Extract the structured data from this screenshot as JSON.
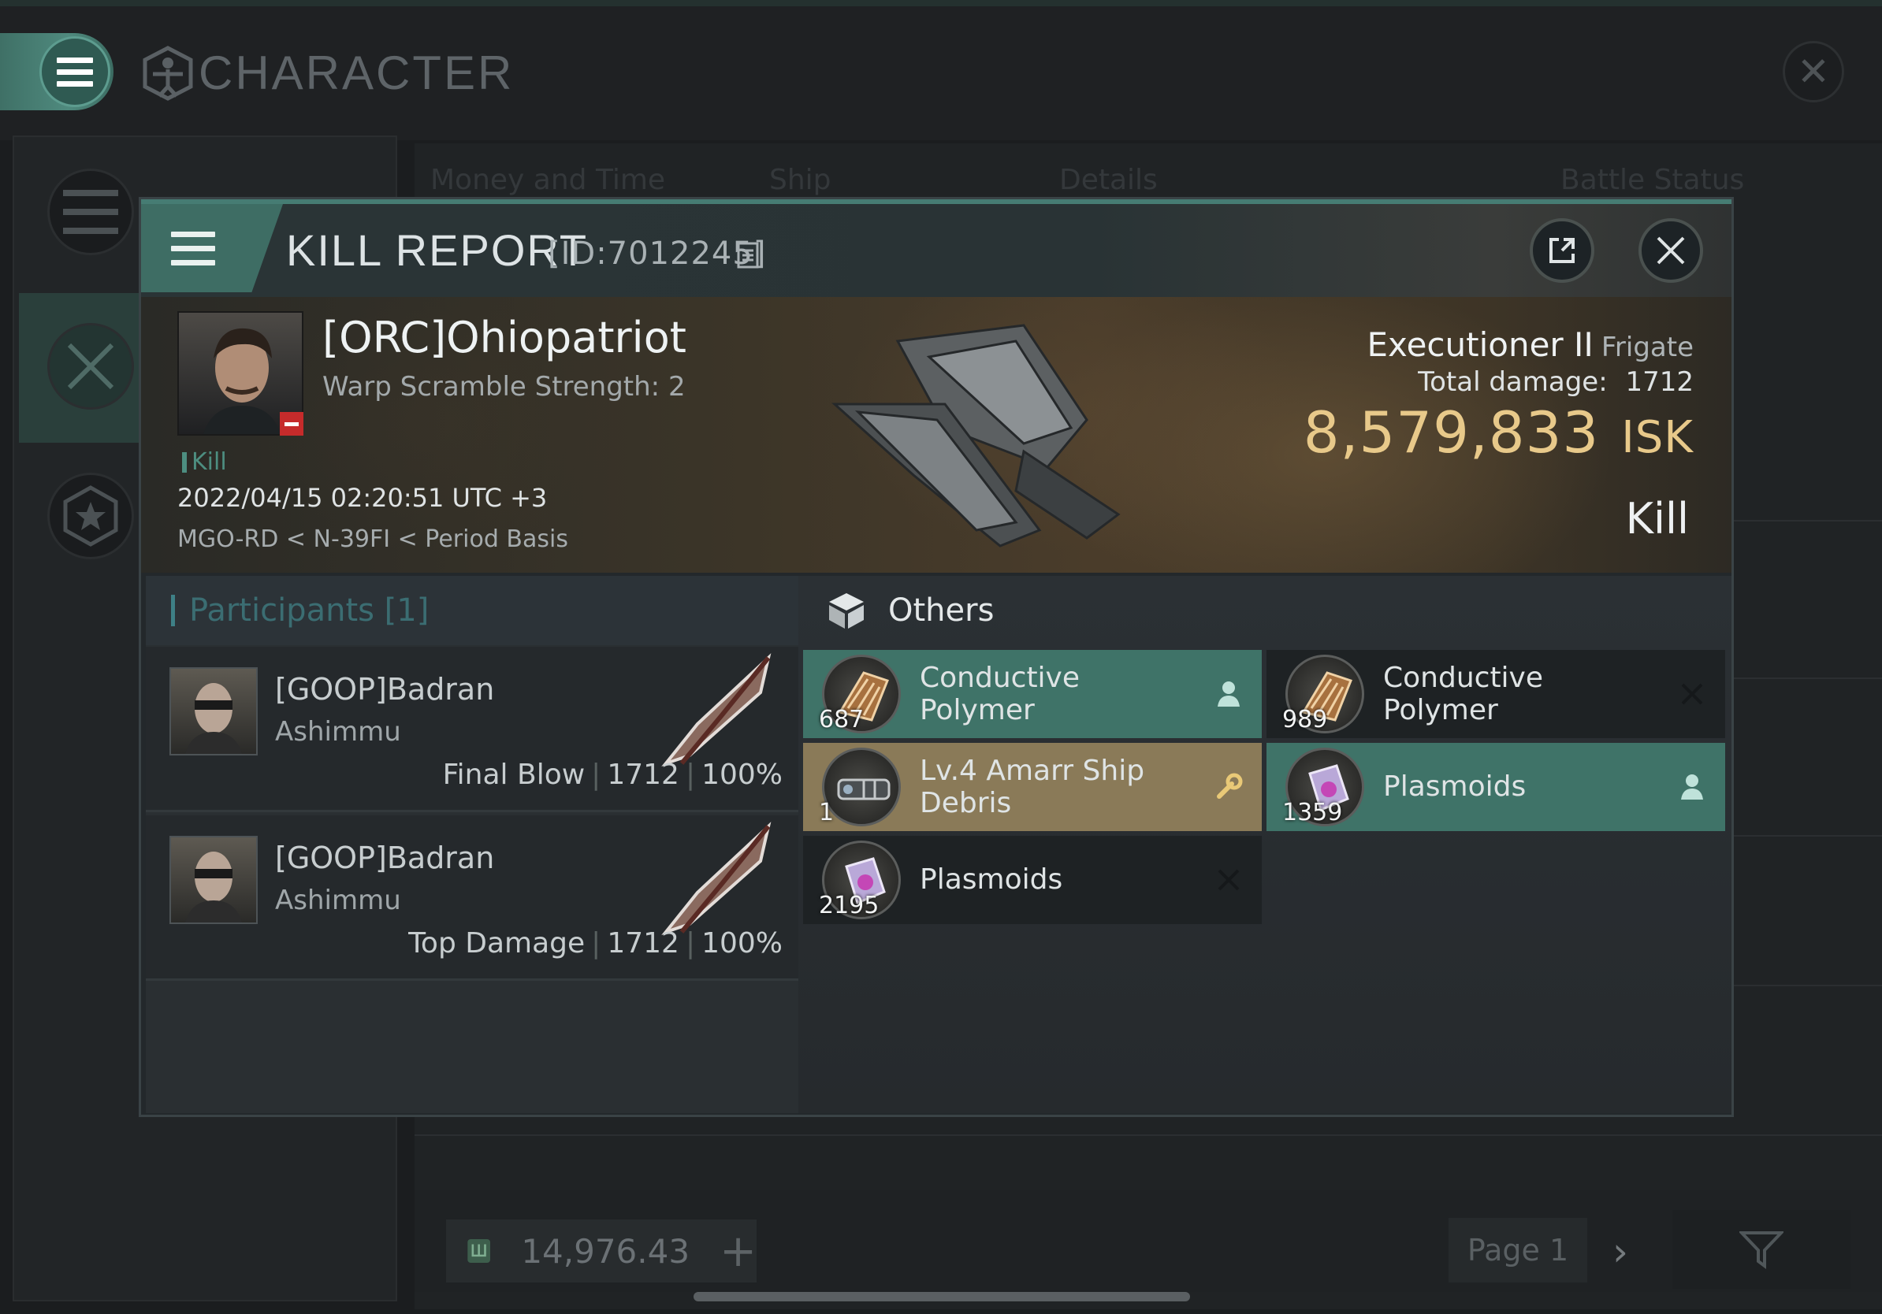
{
  "app": {
    "title": "CHARACTER"
  },
  "background_list": {
    "columns": [
      "Money and Time",
      "Ship",
      "Details",
      "Battle Status"
    ],
    "wallet_value": "14,976.43",
    "page_label": "Page 1"
  },
  "kill_report": {
    "title": "KILL REPORT",
    "id_label": "[ID:7012245]",
    "victim": {
      "name": "[ORC]Ohiopatriot",
      "warp_scramble": "Warp Scramble Strength: 2",
      "tag": "Kill",
      "datetime": "2022/04/15 02:20:51 UTC +3",
      "location": "MGO-RD < N-39FI < Period Basis"
    },
    "ship": {
      "name": "Executioner II",
      "class": "Frigate",
      "total_damage_label": "Total damage:",
      "total_damage": "1712",
      "isk_value": "8,579,833",
      "isk_unit": "ISK",
      "result": "Kill"
    },
    "participants": {
      "header": "Participants [1]",
      "rows": [
        {
          "name": "[GOOP]Badran",
          "ship": "Ashimmu",
          "role": "Final Blow",
          "damage": "1712",
          "percent": "100%"
        },
        {
          "name": "[GOOP]Badran",
          "ship": "Ashimmu",
          "role": "Top Damage",
          "damage": "1712",
          "percent": "100%"
        }
      ]
    },
    "others": {
      "header": "Others",
      "items": [
        {
          "name": "Conductive Polymer",
          "qty": "687",
          "status": "person-icon",
          "style": "green"
        },
        {
          "name": "Conductive Polymer",
          "qty": "989",
          "status": "x-icon",
          "style": "dark"
        },
        {
          "name": "Lv.4 Amarr Ship Debris",
          "qty": "1",
          "status": "wrench-icon",
          "style": "gold"
        },
        {
          "name": "Plasmoids",
          "qty": "1359",
          "status": "person-icon",
          "style": "green"
        },
        {
          "name": "Plasmoids",
          "qty": "2195",
          "status": "x-icon",
          "style": "dark"
        }
      ]
    }
  },
  "colors": {
    "accent_green": "#3f7368",
    "isk_gold": "#e8c98a",
    "loss_red": "#c62b2b"
  }
}
